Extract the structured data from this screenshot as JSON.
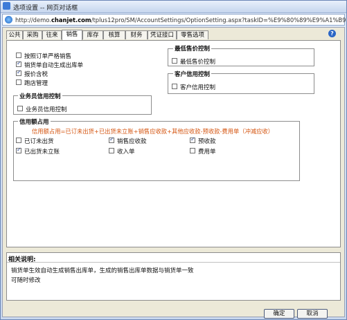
{
  "window": {
    "title": "选项设置 -- 网页对话框",
    "url_prefix": "http://demo.",
    "url_domain": "chanjet.com",
    "url_rest": "/tplus12pro/SM/AccountSettings/OptionSetting.aspx?taskID=%E9%80%89%E9%A1%B9"
  },
  "tabs": [
    "公共",
    "采购",
    "往来",
    "销售",
    "库存",
    "核算",
    "财务",
    "凭证接口",
    "零售选项"
  ],
  "active_tab": "销售",
  "sales": {
    "options": [
      {
        "label": "按照订单严格销售",
        "checked": false
      },
      {
        "label": "销货单自动生成出库单",
        "checked": true
      },
      {
        "label": "报价含税",
        "checked": true
      },
      {
        "label": "跑店管理",
        "checked": false
      }
    ],
    "min_price": {
      "title": "最低售价控制",
      "option": {
        "label": "最低售价控制",
        "checked": false
      }
    },
    "customer_credit": {
      "title": "客户信用控制",
      "option": {
        "label": "客户信用控制",
        "checked": false
      }
    },
    "salesman_credit": {
      "title": "业务员信用控制",
      "option": {
        "label": "业务员信用控制",
        "checked": false
      }
    },
    "credit_usage": {
      "title": "信用额占用",
      "formula": "信用额占用=已订未出货+已出货未立账+销售应收款+其他应收款-预收款-费用单（冲减应收）",
      "items": [
        {
          "label": "已订未出货",
          "checked": false
        },
        {
          "label": "销售应收款",
          "checked": true
        },
        {
          "label": "预收款",
          "checked": true
        },
        {
          "label": "已出货未立账",
          "checked": true
        },
        {
          "label": "收入单",
          "checked": false
        },
        {
          "label": "费用单",
          "checked": false
        }
      ]
    }
  },
  "description": {
    "title": "相关说明:",
    "lines": [
      "销货单生效自动生成销售出库单，生成的销售出库单数据与销货单一致",
      "可随时修改"
    ]
  },
  "buttons": {
    "ok": "确定",
    "cancel": "取消"
  }
}
